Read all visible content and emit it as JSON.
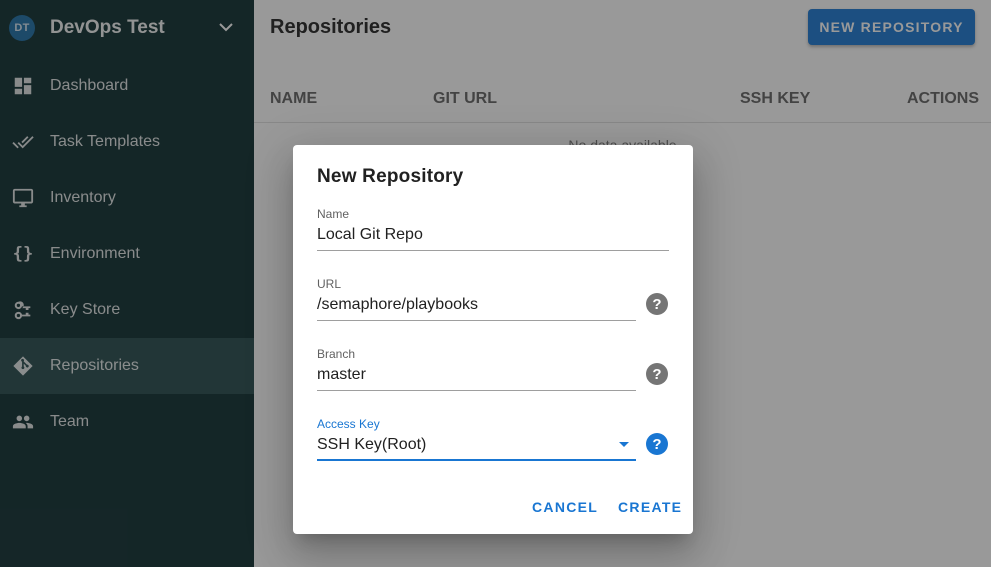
{
  "sidebar": {
    "avatar": "DT",
    "project_name": "DevOps Test",
    "items": [
      {
        "label": "Dashboard",
        "icon": "dashboard-icon"
      },
      {
        "label": "Task Templates",
        "icon": "double-check-icon"
      },
      {
        "label": "Inventory",
        "icon": "monitor-icon"
      },
      {
        "label": "Environment",
        "icon": "braces-icon",
        "glyph": "{}"
      },
      {
        "label": "Key Store",
        "icon": "key-store-icon"
      },
      {
        "label": "Repositories",
        "icon": "git-icon",
        "active": true
      },
      {
        "label": "Team",
        "icon": "people-icon"
      }
    ]
  },
  "main": {
    "title": "Repositories",
    "new_button": "NEW REPOSITORY",
    "columns": [
      "NAME",
      "GIT URL",
      "SSH KEY",
      "ACTIONS"
    ],
    "empty_text": "No data available"
  },
  "dialog": {
    "title": "New Repository",
    "name": {
      "label": "Name",
      "value": "Local Git Repo"
    },
    "url": {
      "label": "URL",
      "value": "/semaphore/playbooks"
    },
    "branch": {
      "label": "Branch",
      "value": "master"
    },
    "access_key": {
      "label": "Access Key",
      "value": "SSH Key(Root)"
    },
    "help_glyph": "?",
    "cancel": "CANCEL",
    "create": "CREATE"
  },
  "colors": {
    "sidebar_bg": "#0a2b2e",
    "sidebar_active": "#24494b",
    "accent": "#1976d2"
  }
}
